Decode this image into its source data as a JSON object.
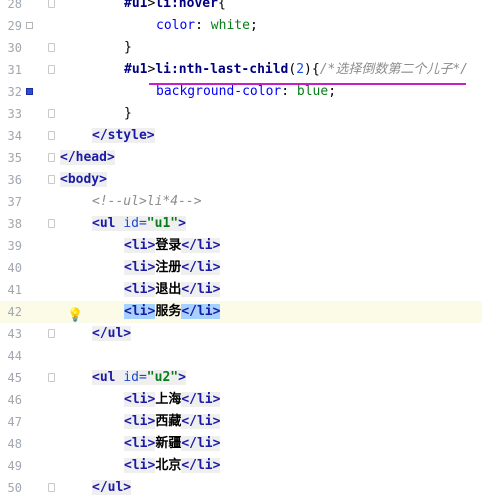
{
  "lines": [
    {
      "n": "28",
      "indent": 2,
      "tokens": [
        {
          "t": "#u1",
          "c": "sel"
        },
        {
          "t": ">",
          "c": "punct"
        },
        {
          "t": "li",
          "c": "sel"
        },
        {
          "t": ":hover",
          "c": "sel"
        },
        {
          "t": "{",
          "c": "punct"
        }
      ]
    },
    {
      "n": "29",
      "indent": 3,
      "tokens": [
        {
          "t": "color",
          "c": "prop"
        },
        {
          "t": ": ",
          "c": "punct"
        },
        {
          "t": "white",
          "c": "val"
        },
        {
          "t": ";",
          "c": "punct"
        }
      ]
    },
    {
      "n": "30",
      "indent": 2,
      "tokens": [
        {
          "t": "}",
          "c": "punct"
        }
      ]
    },
    {
      "n": "31",
      "indent": 2,
      "tokens": [
        {
          "t": "#u1",
          "c": "sel"
        },
        {
          "t": ">",
          "c": "punct"
        },
        {
          "t": "li",
          "c": "sel"
        },
        {
          "t": ":",
          "c": "sel"
        },
        {
          "t": "nth-last-child",
          "c": "sel"
        },
        {
          "t": "(",
          "c": "punct"
        },
        {
          "t": "2",
          "c": "num"
        },
        {
          "t": ")",
          "c": "punct"
        },
        {
          "t": "{",
          "c": "punct"
        },
        {
          "t": "/*选择倒数第二个儿子*/",
          "c": "comment"
        }
      ]
    },
    {
      "n": "32",
      "indent": 3,
      "tokens": [
        {
          "t": "background-color",
          "c": "prop"
        },
        {
          "t": ": ",
          "c": "punct"
        },
        {
          "t": "blue",
          "c": "val"
        },
        {
          "t": ";",
          "c": "punct"
        }
      ]
    },
    {
      "n": "33",
      "indent": 2,
      "tokens": [
        {
          "t": "}",
          "c": "punct"
        }
      ]
    },
    {
      "n": "34",
      "indent": 1,
      "tokens": [
        {
          "t": "</style>",
          "c": "tag tagbg"
        }
      ]
    },
    {
      "n": "35",
      "indent": 0,
      "tokens": [
        {
          "t": "</head>",
          "c": "tag tagbg"
        }
      ]
    },
    {
      "n": "36",
      "indent": 0,
      "tokens": [
        {
          "t": "<body>",
          "c": "tag tagbg"
        }
      ]
    },
    {
      "n": "37",
      "indent": 1,
      "tokens": [
        {
          "t": "<!--ul>li*4-->",
          "c": "comment"
        }
      ]
    },
    {
      "n": "38",
      "indent": 1,
      "tokens": [
        {
          "t": "<ul ",
          "c": "tag tagbg"
        },
        {
          "t": "id=",
          "c": "attr tagbg"
        },
        {
          "t": "\"u1\"",
          "c": "str tagbg"
        },
        {
          "t": ">",
          "c": "tag tagbg"
        }
      ]
    },
    {
      "n": "39",
      "indent": 2,
      "tokens": [
        {
          "t": "<li>",
          "c": "tag tagbg"
        },
        {
          "t": "登录",
          "c": "text"
        },
        {
          "t": "</li>",
          "c": "tag tagbg"
        }
      ]
    },
    {
      "n": "40",
      "indent": 2,
      "tokens": [
        {
          "t": "<li>",
          "c": "tag tagbg"
        },
        {
          "t": "注册",
          "c": "text"
        },
        {
          "t": "</li>",
          "c": "tag tagbg"
        }
      ]
    },
    {
      "n": "41",
      "indent": 2,
      "tokens": [
        {
          "t": "<li>",
          "c": "tag tagbg"
        },
        {
          "t": "退出",
          "c": "text"
        },
        {
          "t": "</li>",
          "c": "tag tagbg"
        }
      ]
    },
    {
      "n": "42",
      "indent": 2,
      "current": true,
      "tokens": [
        {
          "t": "<li>",
          "c": "tag hl"
        },
        {
          "t": "服务",
          "c": "text"
        },
        {
          "t": "</li>",
          "c": "tag hl"
        }
      ]
    },
    {
      "n": "43",
      "indent": 1,
      "tokens": [
        {
          "t": "</ul>",
          "c": "tag tagbg"
        }
      ]
    },
    {
      "n": "44",
      "indent": 0,
      "tokens": []
    },
    {
      "n": "45",
      "indent": 1,
      "tokens": [
        {
          "t": "<ul ",
          "c": "tag tagbg"
        },
        {
          "t": "id=",
          "c": "attr tagbg"
        },
        {
          "t": "\"u2\"",
          "c": "str tagbg"
        },
        {
          "t": ">",
          "c": "tag tagbg"
        }
      ]
    },
    {
      "n": "46",
      "indent": 2,
      "tokens": [
        {
          "t": "<li>",
          "c": "tag tagbg"
        },
        {
          "t": "上海",
          "c": "text"
        },
        {
          "t": "</li>",
          "c": "tag tagbg"
        }
      ]
    },
    {
      "n": "47",
      "indent": 2,
      "tokens": [
        {
          "t": "<li>",
          "c": "tag tagbg"
        },
        {
          "t": "西藏",
          "c": "text"
        },
        {
          "t": "</li>",
          "c": "tag tagbg"
        }
      ]
    },
    {
      "n": "48",
      "indent": 2,
      "tokens": [
        {
          "t": "<li>",
          "c": "tag tagbg"
        },
        {
          "t": "新疆",
          "c": "text"
        },
        {
          "t": "</li>",
          "c": "tag tagbg"
        }
      ]
    },
    {
      "n": "49",
      "indent": 2,
      "tokens": [
        {
          "t": "<li>",
          "c": "tag tagbg"
        },
        {
          "t": "北京",
          "c": "text"
        },
        {
          "t": "</li>",
          "c": "tag tagbg"
        }
      ]
    },
    {
      "n": "50",
      "indent": 1,
      "tokens": [
        {
          "t": "</ul>",
          "c": "tag tagbg"
        }
      ]
    }
  ],
  "gutter_markers": {
    "29": "box",
    "32": "blue"
  },
  "fold_lines": [
    "28",
    "30",
    "31",
    "33",
    "34",
    "35",
    "36",
    "38",
    "43",
    "45",
    "50"
  ],
  "intention_line": "42",
  "icons": {
    "fold": "fold-marker-icon",
    "bulb": "lightbulb-icon",
    "color_swatch_white": "color-swatch-icon",
    "color_swatch_blue": "color-swatch-icon"
  },
  "colors": {
    "tag": "#1a1aa6",
    "selector": "#000080",
    "property": "#0000ff",
    "value": "#067d17",
    "comment": "#8c8c8c",
    "current_line": "#fcfbe8",
    "selection": "#a6d2ff"
  }
}
